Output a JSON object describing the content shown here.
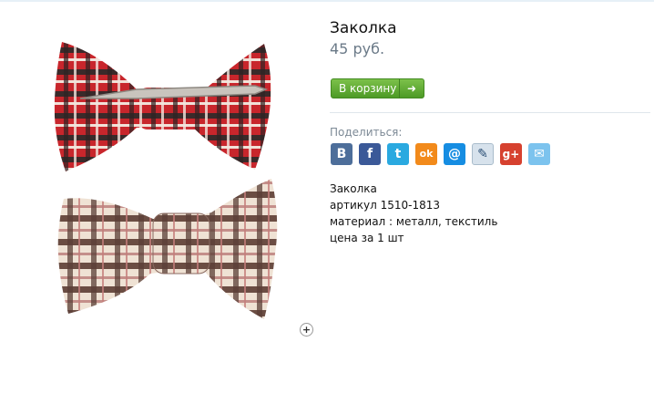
{
  "product": {
    "title": "Заколка",
    "price": "45 руб.",
    "add_to_cart_label": "В корзину",
    "share_label": "Поделиться:",
    "description": [
      "Заколка",
      "артикул 1510-1813",
      "материал : металл, текстиль",
      "цена за 1 шт"
    ]
  },
  "social": [
    {
      "name": "vkontakte-icon",
      "glyph": "B",
      "color": "#4d6e9a"
    },
    {
      "name": "facebook-icon",
      "glyph": "f",
      "color": "#3b5998"
    },
    {
      "name": "twitter-icon",
      "glyph": "t",
      "color": "#2aa9e0"
    },
    {
      "name": "odnoklassniki-icon",
      "glyph": "ok",
      "color": "#f28a1b"
    },
    {
      "name": "mailru-icon",
      "glyph": "@",
      "color": "#168de2"
    },
    {
      "name": "livejournal-icon",
      "glyph": "✎",
      "color": "#d7e2ec"
    },
    {
      "name": "googleplus-icon",
      "glyph": "g+",
      "color": "#d6412f"
    },
    {
      "name": "email-icon",
      "glyph": "✉",
      "color": "#7cc3ee"
    }
  ],
  "zoom_icon": "plus-icon"
}
